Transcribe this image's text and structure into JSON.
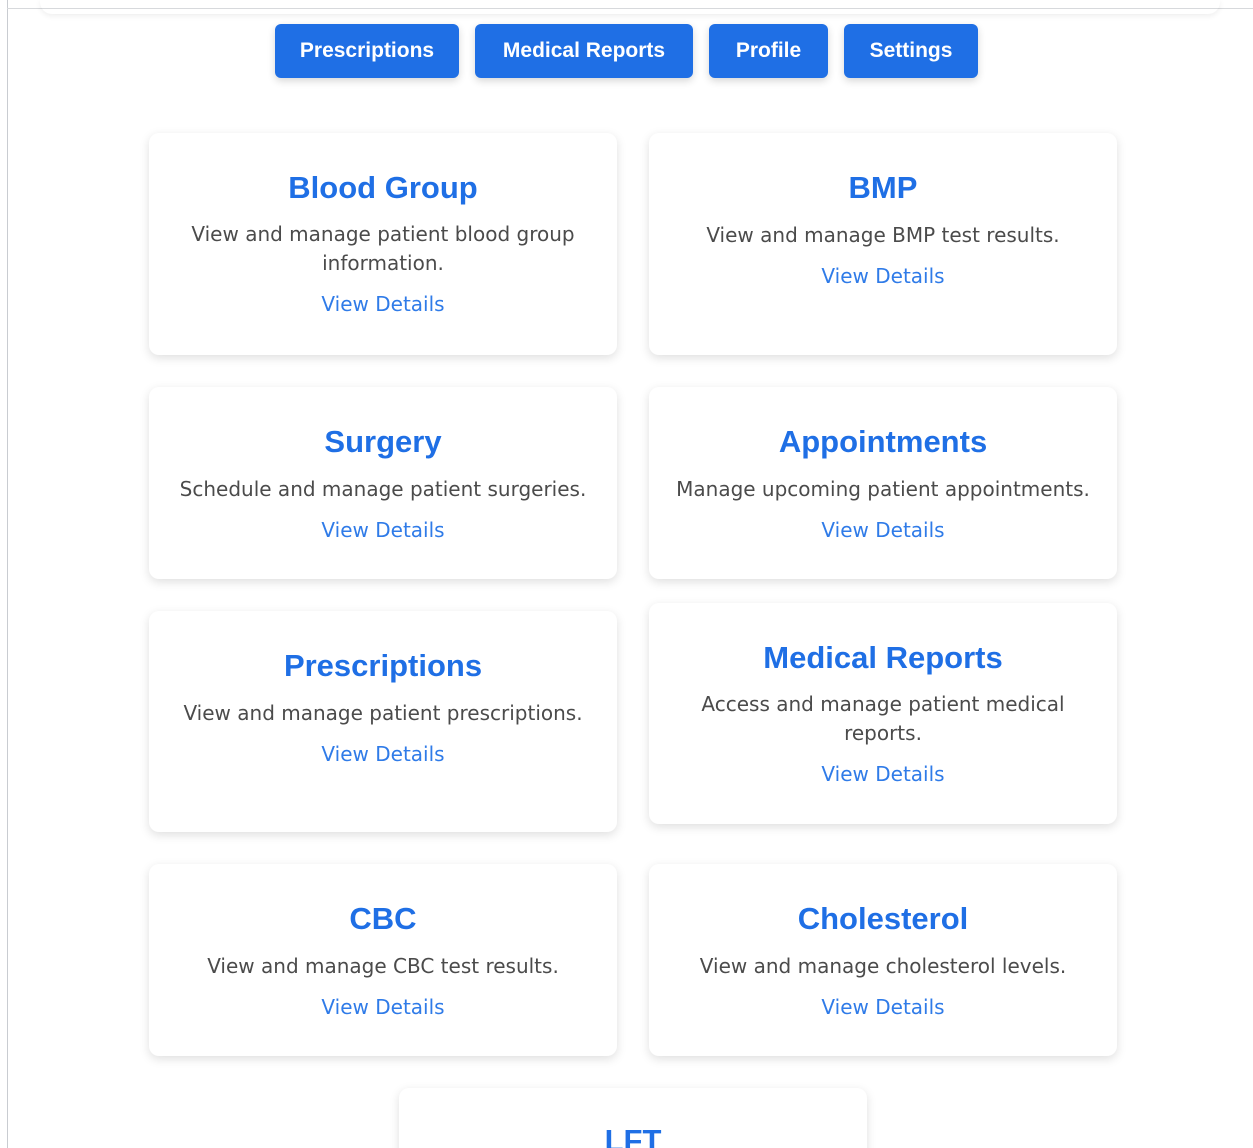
{
  "navigation": {
    "buttons": [
      {
        "label": "Prescriptions"
      },
      {
        "label": "Medical Reports"
      },
      {
        "label": "Profile"
      },
      {
        "label": "Settings"
      }
    ]
  },
  "cards": [
    {
      "title": "Blood Group",
      "description": "View and manage patient blood group information.",
      "link": "View Details"
    },
    {
      "title": "BMP",
      "description": "View and manage BMP test results.",
      "link": "View Details"
    },
    {
      "title": "Surgery",
      "description": "Schedule and manage patient surgeries.",
      "link": "View Details"
    },
    {
      "title": "Appointments",
      "description": "Manage upcoming patient appointments.",
      "link": "View Details"
    },
    {
      "title": "Prescriptions",
      "description": "View and manage patient prescriptions.",
      "link": "View Details"
    },
    {
      "title": "Medical Reports",
      "description": "Access and manage patient medical reports.",
      "link": "View Details"
    },
    {
      "title": "CBC",
      "description": "View and manage CBC test results.",
      "link": "View Details"
    },
    {
      "title": "Cholesterol",
      "description": "View and manage cholesterol levels.",
      "link": "View Details"
    },
    {
      "title": "LFT"
    }
  ],
  "colors": {
    "primary": "#1f6fe5",
    "link": "#2f7be8",
    "text": "#4b4b4b",
    "background": "#ffffff"
  }
}
